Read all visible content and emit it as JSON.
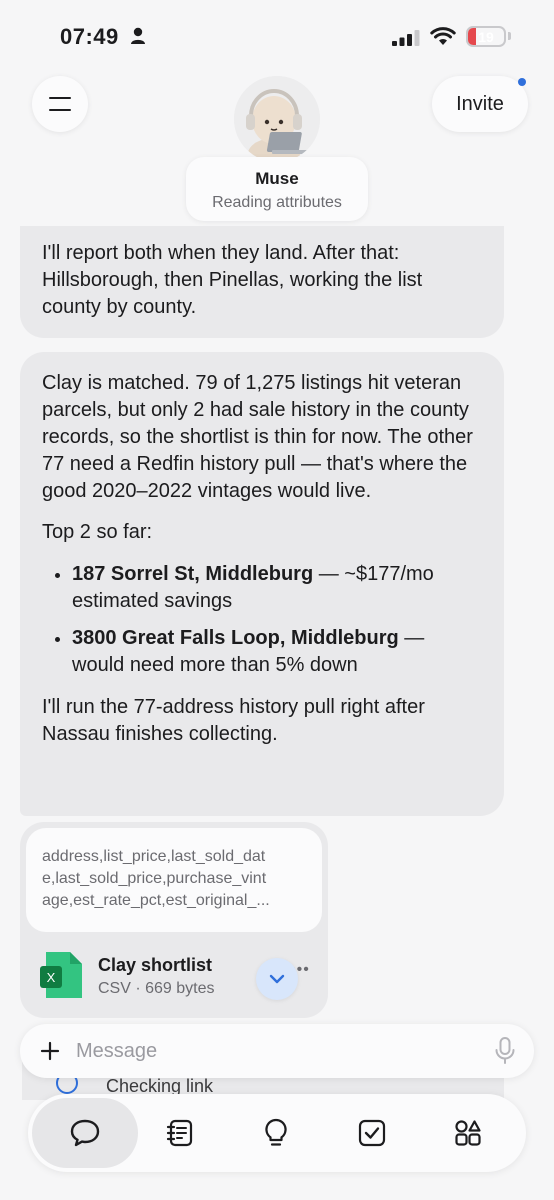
{
  "status_bar": {
    "time": "07:49",
    "battery": "19",
    "battery_fraction": 0.19
  },
  "header": {
    "invite_label": "Invite",
    "agent_name": "Muse",
    "agent_status": "Reading attributes"
  },
  "messages": {
    "m1": "I'll report both when they land. After that: Hillsborough, then Pinellas, working the list county by county.",
    "m2_p1": "Clay is matched. 79 of 1,275 listings hit veteran parcels, but only 2 had sale history in the county records, so the shortlist is thin for now. The other 77 need a Redfin history pull — that's where the good 2020–2022 vintages would live.",
    "m2_p2": "Top 2 so far:",
    "bullets": [
      {
        "bold": "187 Sorrel St, Middleburg",
        "rest": " — ~$177/mo estimated savings"
      },
      {
        "bold": "3800 Great Falls Loop, Middleburg",
        "rest": " — would need more than 5% down"
      }
    ],
    "m2_p3": "I'll run the 77-address history pull right after Nassau finishes collecting."
  },
  "file": {
    "preview_lines": [
      "address,list_price,last_sold_dat",
      "e,last_sold_price,purchase_vint",
      "age,est_rate_pct,est_original_..."
    ],
    "name": "Clay shortlist",
    "meta": "CSV · 669 bytes",
    "icon_letter": "X",
    "more": "•••"
  },
  "behind_text": "Checking link",
  "composer": {
    "placeholder": "Message"
  },
  "tabs": [
    "chat-icon",
    "notes-icon",
    "lightbulb-icon",
    "tasks-icon",
    "apps-icon"
  ],
  "colors": {
    "accent": "#2f6fdb",
    "bubble": "#e9e9eb",
    "excel_green": "#21a366"
  }
}
